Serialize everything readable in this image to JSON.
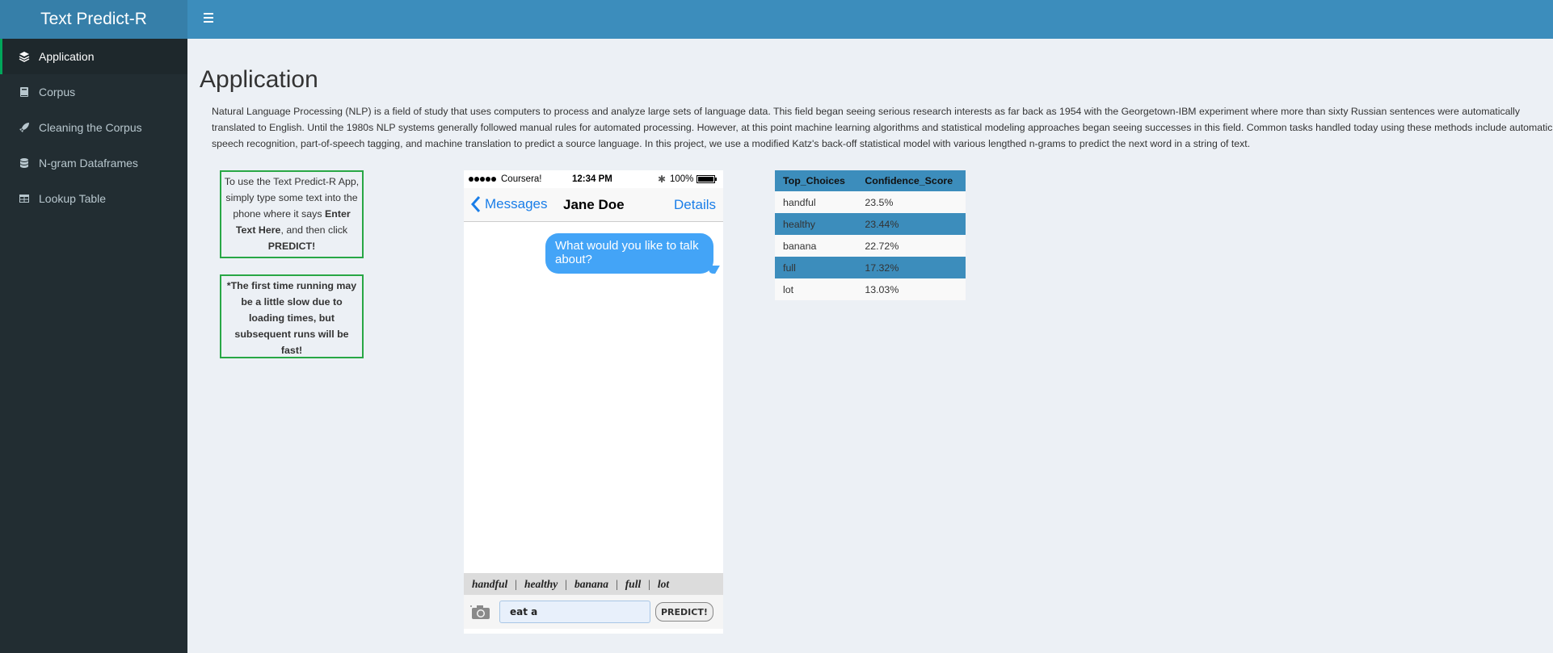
{
  "app": {
    "title": "Text Predict-R"
  },
  "sidebar": {
    "items": [
      {
        "label": "Application",
        "icon": "layers-icon",
        "active": true
      },
      {
        "label": "Corpus",
        "icon": "book-icon"
      },
      {
        "label": "Cleaning the Corpus",
        "icon": "rocket-icon"
      },
      {
        "label": "N-gram Dataframes",
        "icon": "database-icon"
      },
      {
        "label": "Lookup Table",
        "icon": "table-icon"
      }
    ]
  },
  "main": {
    "title": "Application",
    "intro": "Natural Language Processing (NLP) is a field of study that uses computers to process and analyze large sets of language data. This field began seeing serious research interests as far back as 1954 with the Georgetown-IBM experiment where more than sixty Russian sentences were automatically translated to English. Until the 1980s NLP systems generally followed manual rules for automated processing. However, at this point machine learning algorithms and statistical modeling approaches began seeing successes in this field. Common tasks handled today using these methods include automatic speech recognition, part-of-speech tagging, and machine translation to predict a source language. In this project, we use a modified Katz's back-off statistical model with various lengthed n-grams to predict the next word in a string of text.",
    "note1": {
      "pre": "To use the Text Predict-R App, simply type some text into the phone where it says ",
      "bold1": "Enter Text Here",
      "mid": ", and then click ",
      "bold2": "PREDICT!"
    },
    "note2": "*The first time running may be a little slow due to loading times, but subsequent runs will be fast!"
  },
  "phone": {
    "carrier": "Coursera!",
    "time": "12:34 PM",
    "bluetooth": "✱",
    "battery": "100%",
    "back_label": "Messages",
    "contact": "Jane Doe",
    "details_label": "Details",
    "bubble": "What would you like to talk about?",
    "suggestions": [
      "handful",
      "healthy",
      "banana",
      "full",
      "lot"
    ],
    "input_value": "eat a",
    "predict_label": "PREDICT!"
  },
  "table": {
    "headers": [
      "Top_Choices",
      "Confidence_Score"
    ],
    "rows": [
      [
        "handful",
        "23.5%"
      ],
      [
        "healthy",
        "23.44%"
      ],
      [
        "banana",
        "22.72%"
      ],
      [
        "full",
        "17.32%"
      ],
      [
        "lot",
        "13.03%"
      ]
    ]
  },
  "colors": {
    "header": "#3c8dbc",
    "logo": "#367fa9",
    "sidebar": "#222d32",
    "accent_green": "#00a65a",
    "bubble": "#43a4f7"
  }
}
